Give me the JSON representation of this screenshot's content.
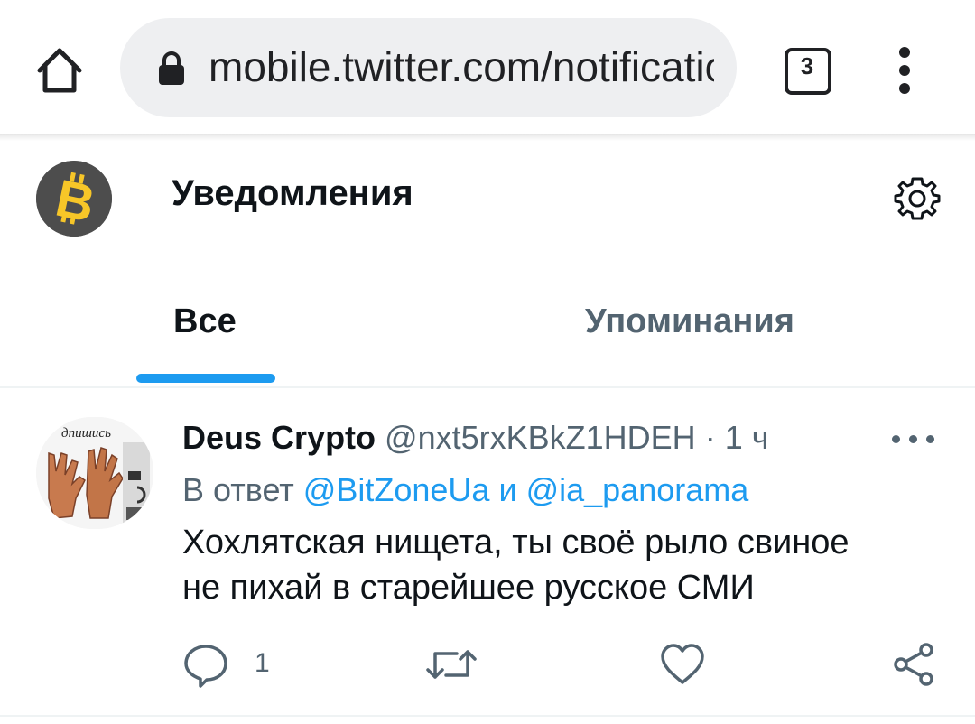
{
  "browser": {
    "url": "mobile.twitter.com/notificatio",
    "tab_count": "3",
    "icons": {
      "home": "home-icon",
      "lock": "lock-icon",
      "tabs": "tabs-icon",
      "menu": "more-vert-icon"
    }
  },
  "header": {
    "title": "Уведомления",
    "avatar_icon": "bitcoin-icon",
    "settings_icon": "gear-icon"
  },
  "tabs": [
    {
      "label": "Все",
      "selected": true
    },
    {
      "label": "Упоминания",
      "selected": false
    }
  ],
  "colors": {
    "accent": "#1d9bf0",
    "text": "#0f1419",
    "secondary": "#536471",
    "bitcoin": "#f7c628"
  },
  "tweet": {
    "author_name": "Deus Crypto",
    "author_handle": "@nxt5rxKBkZ1HDEH",
    "separator": "·",
    "time": "1 ч",
    "reply_prefix": "В ответ",
    "reply_to_1": "@BitZoneUa",
    "reply_conj": "и",
    "reply_to_2": "@ia_panorama",
    "text_line_1": "Хохлятская нищета, ты своё рыло свиное",
    "text_line_2": "не пихай в старейшее русское СМИ",
    "avatar_text": "дпишись",
    "actions": {
      "reply_count": "1",
      "icons": [
        "reply-icon",
        "retweet-icon",
        "like-icon",
        "share-icon"
      ]
    }
  }
}
